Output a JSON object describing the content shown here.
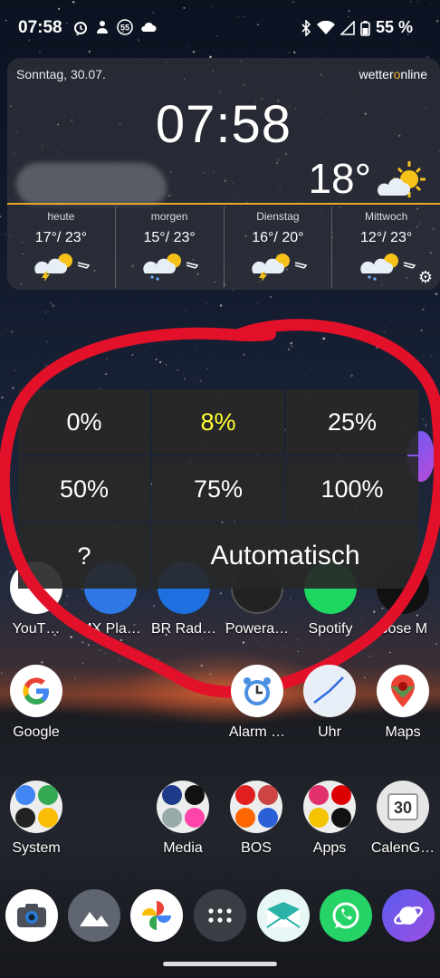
{
  "status_bar": {
    "time": "07:58",
    "battery_text": "55 %",
    "badge": "55"
  },
  "weather_widget": {
    "date": "Sonntag, 30.07.",
    "brand_pre": "wetter",
    "brand_o": "o",
    "brand_post": "nline",
    "clock": "07:58",
    "current_temp": "18°",
    "accent_color": "#e9a72a",
    "days": [
      {
        "name": "heute",
        "range": "17°/ 23°"
      },
      {
        "name": "morgen",
        "range": "15°/ 23°"
      },
      {
        "name": "Dienstag",
        "range": "16°/ 20°"
      },
      {
        "name": "Mittwoch",
        "range": "12°/ 23°"
      }
    ]
  },
  "brightness_panel": {
    "options": [
      "0%",
      "8%",
      "25%",
      "50%",
      "75%",
      "100%"
    ],
    "selected": "8%",
    "selected_color": "#ffff33",
    "help": "?",
    "auto": "Automatisch"
  },
  "apps_row_partial": [
    "YouT…",
    "MX Pla…",
    "BR Rad…",
    "Powera…",
    "Spotify",
    "Bose M"
  ],
  "apps_row_1": [
    "Google",
    "Alarm …",
    "Uhr",
    "Maps"
  ],
  "apps_row_2": [
    "System",
    "Media",
    "BOS",
    "Apps",
    "CalenG…"
  ],
  "calendar_icon_day": "30",
  "dock": [
    "camera-icon",
    "gallery-icon",
    "photos-icon",
    "app-drawer-icon",
    "mail-icon",
    "whatsapp-icon",
    "browser-icon"
  ]
}
